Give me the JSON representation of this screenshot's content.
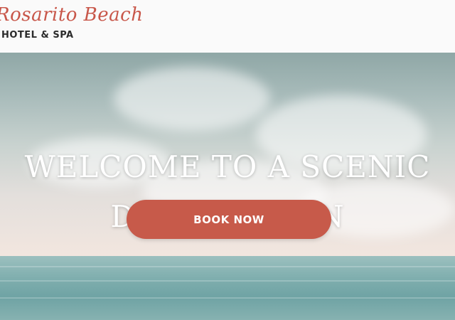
{
  "header": {
    "logo_script": "Rosarito Beach",
    "logo_sub": "HOTEL & SPA"
  },
  "hero": {
    "title_line1": "WELCOME TO A SCENIC",
    "title_line2": "DESTINATION",
    "cta_label": "BOOK NOW"
  },
  "colors": {
    "brand_red": "#c75a4a",
    "logo_script": "#c8574a",
    "header_bg": "#fafafa"
  }
}
